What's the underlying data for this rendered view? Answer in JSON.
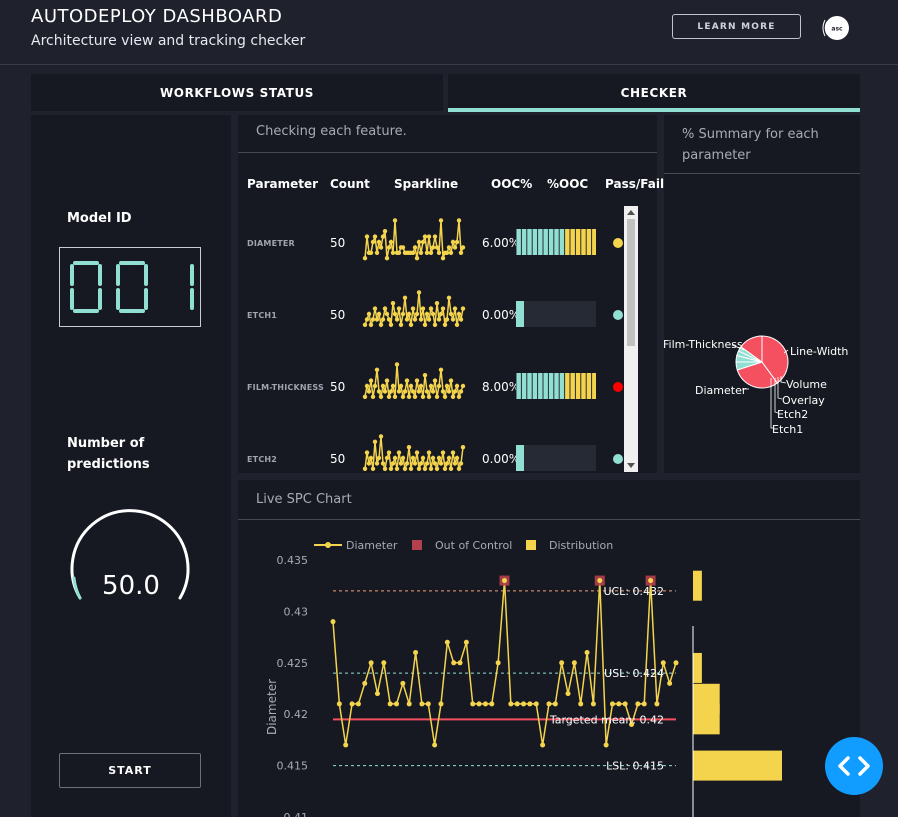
{
  "header": {
    "title": "AUTODEPLOY DASHBOARD",
    "subtitle": "Architecture view and tracking checker",
    "learn_more": "LEARN MORE",
    "logo_text": "asc"
  },
  "tabs": [
    {
      "label": "WORKFLOWS STATUS",
      "active": false
    },
    {
      "label": "CHECKER",
      "active": true
    }
  ],
  "left_panel": {
    "model_id_label": "Model ID",
    "model_id_value": "001",
    "predictions_label_line1": "Number of",
    "predictions_label_line2": "predictions",
    "predictions_value": "50.0",
    "start_label": "START"
  },
  "checker": {
    "title": "Checking each feature.",
    "columns": [
      "Parameter",
      "Count",
      "Sparkline",
      "OOC%",
      "%OOC",
      "Pass/Fail"
    ],
    "rows": [
      {
        "name": "DIAMETER",
        "count": "50",
        "ooc": "6.00%",
        "ooc_fraction": 0.06,
        "status": "warning",
        "spark": [
          0.2,
          0.6,
          0.3,
          0.3,
          0.5,
          0.6,
          0.3,
          0.5,
          0.4,
          0.6,
          0.7,
          0.2,
          0.4,
          0.5,
          0.3,
          0.9,
          0.3,
          0.3,
          0.4,
          0.4,
          0.3,
          0.3,
          0.3,
          0.3,
          0.3,
          0.4,
          0.2,
          0.5,
          0.3,
          0.5,
          0.6,
          0.3,
          0.6,
          0.3,
          0.4,
          0.6,
          0.4,
          0.3,
          0.9,
          0.2,
          0.3,
          0.3,
          0.4,
          0.3,
          0.5,
          0.4,
          0.5,
          0.9,
          0.3,
          0.4
        ]
      },
      {
        "name": "ETCH1",
        "count": "50",
        "ooc": "0.00%",
        "ooc_fraction": 0.0,
        "status": "pass",
        "spark": [
          0.3,
          0.4,
          0.5,
          0.3,
          0.4,
          0.6,
          0.4,
          0.5,
          0.3,
          0.4,
          0.6,
          0.5,
          0.4,
          0.3,
          0.7,
          0.5,
          0.4,
          0.6,
          0.3,
          0.5,
          0.8,
          0.4,
          0.5,
          0.3,
          0.6,
          0.4,
          0.5,
          0.9,
          0.4,
          0.6,
          0.3,
          0.5,
          0.4,
          0.6,
          0.5,
          0.3,
          0.7,
          0.4,
          0.5,
          0.6,
          0.3,
          0.4,
          0.8,
          0.5,
          0.4,
          0.6,
          0.3,
          0.5,
          0.4,
          0.6
        ]
      },
      {
        "name": "FILM-THICKNESS",
        "count": "50",
        "ooc": "8.00%",
        "ooc_fraction": 0.08,
        "status": "fail",
        "spark": [
          0.3,
          0.5,
          0.4,
          0.6,
          0.3,
          0.5,
          0.8,
          0.4,
          0.3,
          0.5,
          0.4,
          0.6,
          0.3,
          0.4,
          0.5,
          0.3,
          0.9,
          0.4,
          0.5,
          0.3,
          0.4,
          0.6,
          0.3,
          0.5,
          0.4,
          0.3,
          0.6,
          0.4,
          0.5,
          0.3,
          0.7,
          0.4,
          0.3,
          0.5,
          0.4,
          0.6,
          0.3,
          0.5,
          0.8,
          0.4,
          0.3,
          0.5,
          0.4,
          0.6,
          0.3,
          0.4,
          0.5,
          0.3,
          0.4,
          0.5
        ]
      },
      {
        "name": "ETCH2",
        "count": "50",
        "ooc": "0.00%",
        "ooc_fraction": 0.0,
        "status": "pass",
        "spark": [
          0.3,
          0.6,
          0.4,
          0.5,
          0.3,
          0.8,
          0.4,
          0.5,
          0.9,
          0.4,
          0.3,
          0.5,
          0.6,
          0.3,
          0.4,
          0.5,
          0.3,
          0.6,
          0.4,
          0.5,
          0.3,
          0.4,
          0.7,
          0.3,
          0.5,
          0.4,
          0.6,
          0.3,
          0.4,
          0.5,
          0.3,
          0.4,
          0.6,
          0.3,
          0.5,
          0.4,
          0.3,
          0.5,
          0.4,
          0.6,
          0.3,
          0.4,
          0.5,
          0.3,
          0.6,
          0.4,
          0.5,
          0.3,
          0.4,
          0.7
        ]
      }
    ]
  },
  "summary": {
    "title_line1": "% Summary for each",
    "title_line2": "parameter",
    "slices": [
      {
        "label": "Film-Thickness",
        "value": 40,
        "color": "#f45060"
      },
      {
        "label": "Line-Width",
        "value": 30,
        "color": "#f45060"
      },
      {
        "label": "Volume",
        "value": 5,
        "color": "#91dfd2"
      },
      {
        "label": "Overlay",
        "value": 4,
        "color": "#91dfd2"
      },
      {
        "label": "Etch2",
        "value": 3,
        "color": "#91dfd2"
      },
      {
        "label": "Etch1",
        "value": 3,
        "color": "#91dfd2"
      },
      {
        "label": "Diameter",
        "value": 15,
        "color": "#f45060"
      }
    ]
  },
  "spc": {
    "title": "Live SPC Chart",
    "legend": {
      "line": "Diameter",
      "ooc": "Out of Control",
      "dist": "Distribution"
    },
    "colors": {
      "line": "#f4d44d",
      "ooc": "#b3404d",
      "target": "#f45060",
      "limits": "#91dfd2",
      "ucl": "#f4a07a"
    },
    "labels": {
      "ucl": "UCL: 0.432",
      "usl": "USL: 0.424",
      "target": "Targeted mean: 0.42",
      "lsl": "LSL: 0.415"
    }
  },
  "chart_data": {
    "type": "line",
    "title": "",
    "ylabel": "Diameter",
    "ylim": [
      0.41,
      0.435
    ],
    "yticks": [
      "0.435",
      "0.43",
      "0.425",
      "0.42",
      "0.415",
      "0.41"
    ],
    "series": [
      {
        "name": "Diameter",
        "values": [
          0.429,
          0.421,
          0.417,
          0.421,
          0.421,
          0.423,
          0.425,
          0.422,
          0.425,
          0.421,
          0.421,
          0.423,
          0.421,
          0.426,
          0.421,
          0.421,
          0.417,
          0.421,
          0.427,
          0.425,
          0.425,
          0.427,
          0.421,
          0.421,
          0.421,
          0.421,
          0.425,
          0.433,
          0.421,
          0.421,
          0.421,
          0.421,
          0.421,
          0.417,
          0.421,
          0.421,
          0.425,
          0.422,
          0.425,
          0.421,
          0.426,
          0.421,
          0.433,
          0.417,
          0.421,
          0.421,
          0.421,
          0.419,
          0.421,
          0.421,
          0.433,
          0.421,
          0.425,
          0.423,
          0.425
        ]
      }
    ],
    "out_of_control_index": [
      27,
      42,
      50
    ],
    "control_lines": {
      "ucl": 0.432,
      "usl": 0.424,
      "target": 0.4195,
      "lsl": 0.415
    },
    "distribution": [
      {
        "y": 0.4325,
        "count": 2
      },
      {
        "y": 0.4245,
        "count": 2
      },
      {
        "y": 0.4215,
        "count": 6
      },
      {
        "y": 0.4195,
        "count": 6
      },
      {
        "y": 0.415,
        "count": 20
      }
    ]
  }
}
